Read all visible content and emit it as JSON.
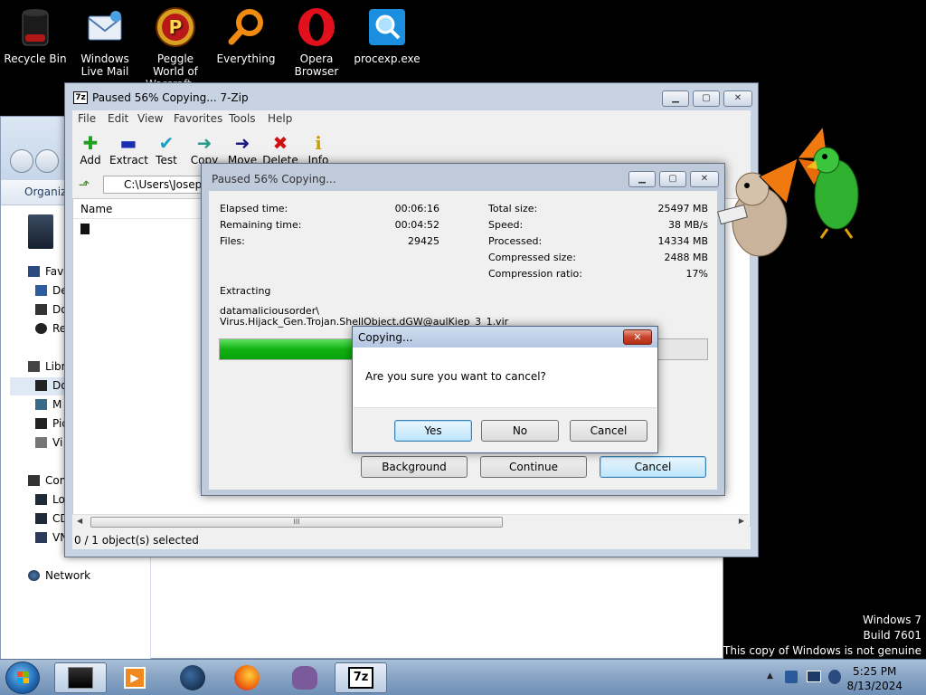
{
  "desktop": {
    "icons": [
      {
        "label": "Recycle Bin",
        "icon": "recycle-bin-icon"
      },
      {
        "label": "Windows Live Mail",
        "icon": "mail-icon"
      },
      {
        "label": "Peggle World of Warcraft ...",
        "icon": "peggle-icon"
      },
      {
        "label": "Everything",
        "icon": "everything-search-icon"
      },
      {
        "label": "Opera Browser",
        "icon": "opera-icon"
      },
      {
        "label": "procexp.exe",
        "icon": "procexp-icon"
      }
    ],
    "watermark": [
      "Windows 7",
      "Build 7601",
      "This copy of Windows is not genuine"
    ]
  },
  "explorer": {
    "organize_label": "Organize",
    "nav": {
      "favorites_label": "Favo",
      "favorites_items": [
        "De",
        "Do",
        "Re"
      ],
      "libraries_label": "Libra",
      "libraries_items": [
        "Do",
        "M",
        "Pic",
        "Vi"
      ],
      "computer_label": "Com",
      "computer_items": [
        "Lo",
        "CD",
        "VN"
      ],
      "network_label": "Network"
    }
  },
  "zip_window": {
    "title": "Paused 56% Copying... 7-Zip",
    "icon_text": "7z",
    "menu": [
      "File",
      "Edit",
      "View",
      "Favorites",
      "Tools",
      "Help"
    ],
    "toolbar": [
      {
        "label": "Add",
        "icon": "add-icon",
        "glyph": "✚",
        "color": "#1ea01e"
      },
      {
        "label": "Extract",
        "icon": "extract-icon",
        "glyph": "▬",
        "color": "#1a2fb0"
      },
      {
        "label": "Test",
        "icon": "test-icon",
        "glyph": "✔",
        "color": "#1aa0c0"
      },
      {
        "label": "Copy",
        "icon": "copy-icon",
        "glyph": "➜",
        "color": "#2a9a8a"
      },
      {
        "label": "Move",
        "icon": "move-icon",
        "glyph": "➜",
        "color": "#1a1a80"
      },
      {
        "label": "Delete",
        "icon": "delete-icon",
        "glyph": "✖",
        "color": "#d01010"
      },
      {
        "label": "Info",
        "icon": "info-icon",
        "glyph": "i",
        "color": "#c8a000"
      }
    ],
    "address": "C:\\Users\\Joseph",
    "column_name": "Name",
    "scroll_grip": "III",
    "status": "0 / 1 object(s) selected"
  },
  "progress_dialog": {
    "title": "Paused 56% Copying...",
    "left_stats": [
      {
        "label": "Elapsed time:",
        "value": "00:06:16"
      },
      {
        "label": "Remaining time:",
        "value": "00:04:52"
      },
      {
        "label": "Files:",
        "value": "29425"
      }
    ],
    "right_stats": [
      {
        "label": "Total size:",
        "value": "25497 MB"
      },
      {
        "label": "Speed:",
        "value": "38 MB/s"
      },
      {
        "label": "Processed:",
        "value": "14334 MB"
      },
      {
        "label": "Compressed size:",
        "value": "2488 MB"
      },
      {
        "label": "Compression ratio:",
        "value": "17%"
      }
    ],
    "operation": "Extracting",
    "path_line1": "datamaliciousorder\\",
    "path_line2": "Virus.Hijack_Gen.Trojan.ShellObject.dGW@aulKiep_3_1.vir",
    "progress_percent": 56,
    "buttons": {
      "background": "Background",
      "continue": "Continue",
      "cancel": "Cancel"
    }
  },
  "confirm_dialog": {
    "title": "Copying...",
    "close_label": "✕",
    "message": "Are you sure you want to cancel?",
    "buttons": {
      "yes": "Yes",
      "no": "No",
      "cancel": "Cancel"
    }
  },
  "taskbar": {
    "time": "5:25 PM",
    "date": "8/13/2024",
    "apps": [
      "terminal-app-icon",
      "media-player-icon",
      "browser-globe-icon",
      "firefox-icon",
      "gimp-icon",
      "7zip-icon"
    ],
    "active_app_text": "7z"
  }
}
